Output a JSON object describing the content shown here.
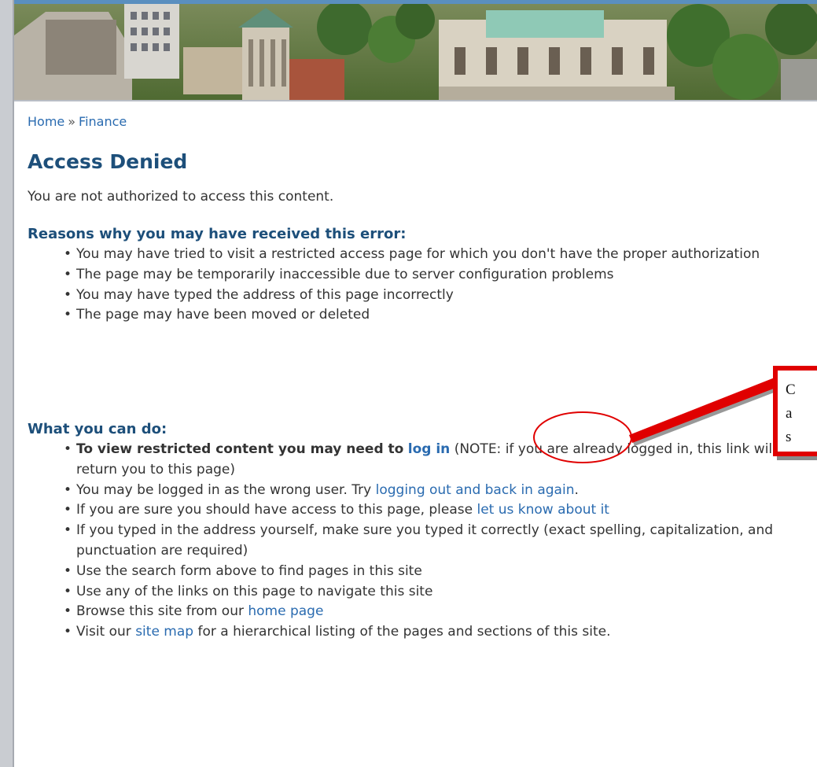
{
  "breadcrumb": {
    "home": "Home",
    "separator": "»",
    "current": "Finance"
  },
  "page_title": "Access Denied",
  "lead": "You are not authorized to access this content.",
  "reasons": {
    "title": "Reasons why you may have received this error:",
    "items": [
      "You may have tried to visit a restricted access page for which you don't have the proper authorization",
      "The page may be temporarily inaccessible due to server configuration problems",
      "You may have typed the address of this page incorrectly",
      "The page may have been moved or deleted"
    ]
  },
  "actions": {
    "title": "What you can do:",
    "item1": {
      "bold": "To view restricted content you may need to",
      "link": "log in",
      "rest": "(NOTE: if you are already logged in, this link will return you to this page)"
    },
    "item2": {
      "text": "You may be logged in as the wrong user. Try",
      "link": "logging out and back in again",
      "end": "."
    },
    "item3": {
      "text": "If you are sure you should have access to this page, please",
      "link": "let us know about it"
    },
    "item4": "If you typed in the address yourself, make sure you typed it correctly (exact spelling, capitalization, and punctuation are required)",
    "item5": "Use the search form above to find pages in this site",
    "item6": "Use any of the links on this page to navigate this site",
    "item7": {
      "text": "Browse this site from our",
      "link": "home page"
    },
    "item8": {
      "text": "Visit our",
      "link": "site map",
      "rest": "for a hierarchical listing of the pages and sections of this site."
    }
  },
  "callout": {
    "lines": [
      "C",
      "a",
      "s"
    ]
  },
  "colors": {
    "link": "#2a6bb0",
    "heading": "#1d4f7a",
    "annotation": "#e00000"
  }
}
